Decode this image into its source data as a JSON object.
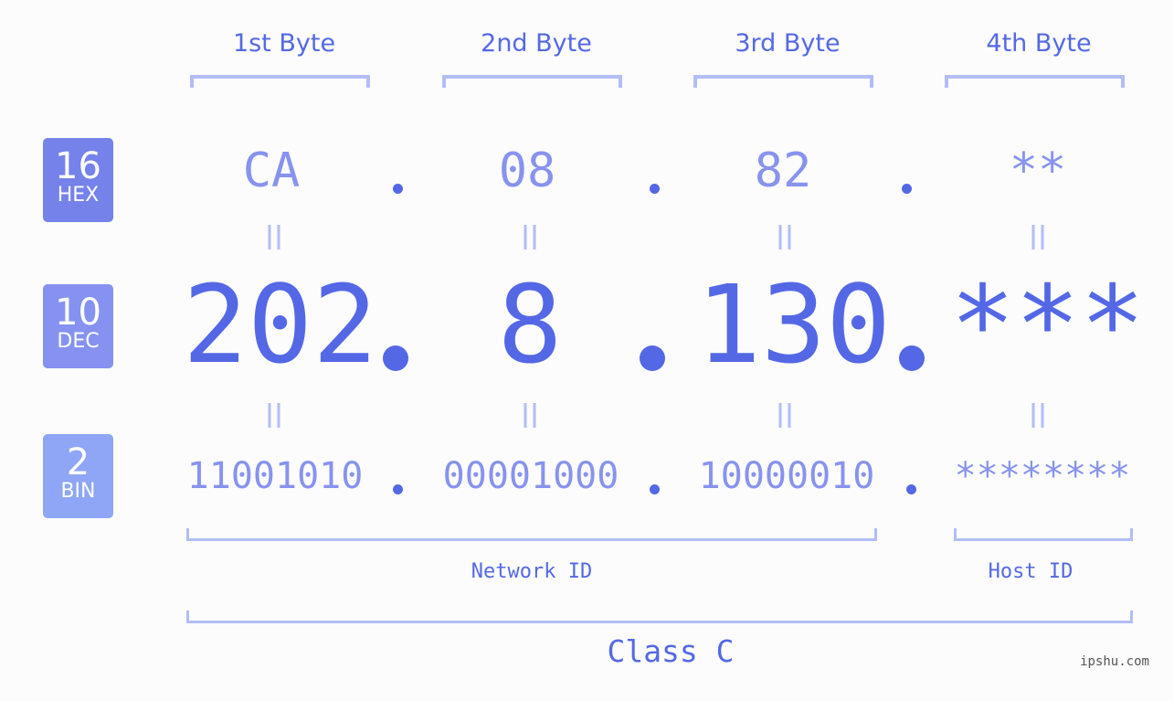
{
  "bytes": [
    {
      "label": "1st Byte",
      "hex": "CA",
      "dec": "202",
      "bin": "11001010"
    },
    {
      "label": "2nd Byte",
      "hex": "08",
      "dec": "8",
      "bin": "00001000"
    },
    {
      "label": "3rd Byte",
      "hex": "82",
      "dec": "130",
      "bin": "10000010"
    },
    {
      "label": "4th Byte",
      "hex": "**",
      "dec": "***",
      "bin": "********"
    }
  ],
  "bases": [
    {
      "num": "16",
      "label": "HEX",
      "color": "#7582ea"
    },
    {
      "num": "10",
      "label": "DEC",
      "color": "#8592ef"
    },
    {
      "num": "2",
      "label": "BIN",
      "color": "#8fa6f6"
    }
  ],
  "separator": ".",
  "equals": "=",
  "network_label": "Network ID",
  "host_label": "Host ID",
  "class_label": "Class C",
  "watermark": "ipshu.com",
  "colors": {
    "primary": "#5468e6",
    "secondary": "#8793ee",
    "bracket": "#b3bdf6",
    "background": "#fbfcfb"
  }
}
